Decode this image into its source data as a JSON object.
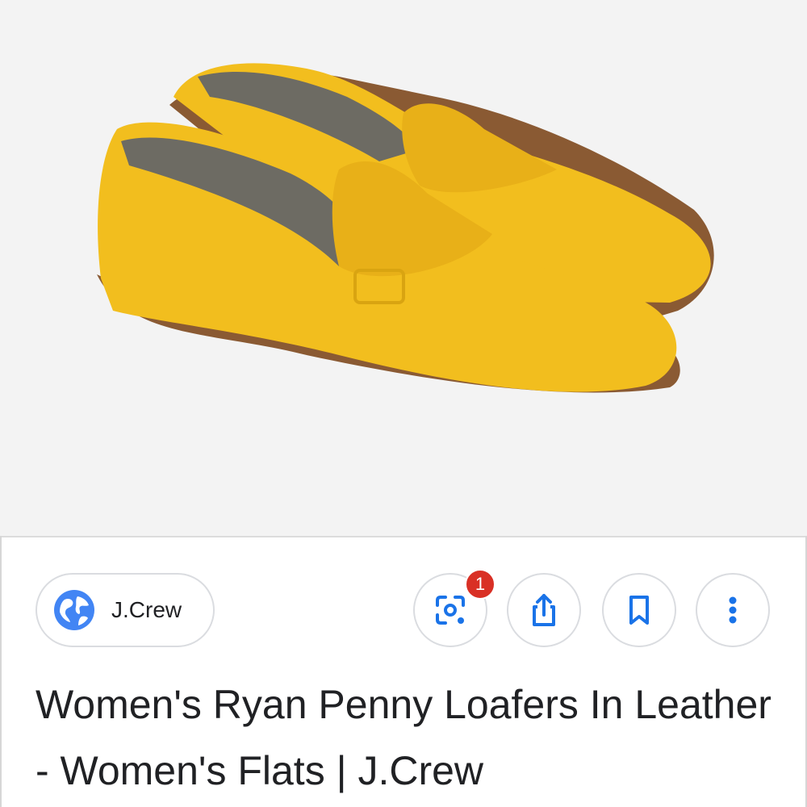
{
  "image": {
    "subject": "yellow-penny-loafers",
    "colors": {
      "leather": "#f2be1e",
      "sole": "#8a5a33",
      "lining": "#6d6b63",
      "background": "#f3f3f3"
    }
  },
  "source": {
    "name": "J.Crew",
    "icon": "globe-icon",
    "icon_color": "#4285f4"
  },
  "actions": {
    "lens": {
      "icon": "lens-icon",
      "badge": "1"
    },
    "share": {
      "icon": "share-icon"
    },
    "save": {
      "icon": "bookmark-icon"
    },
    "more": {
      "icon": "more-vert-icon"
    },
    "icon_color": "#1a73e8",
    "badge_color": "#d93025"
  },
  "title": "Women's Ryan Penny Loafers In Leather - Women's Flats | J.Crew"
}
